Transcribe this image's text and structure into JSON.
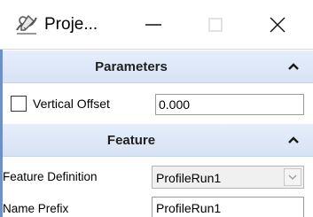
{
  "window": {
    "title": "Proje...",
    "controls": {
      "minimize": "minimize-icon",
      "maximize": "maximize-icon",
      "close": "close-icon"
    },
    "app_icon": "project-profile-icon"
  },
  "colors": {
    "section_header_top": "#e6eefb",
    "section_header_bottom": "#d6e2f5",
    "accent_strip": "#6f8fc9"
  },
  "sections": {
    "parameters": {
      "title": "Parameters",
      "collapse_icon": "chevron-up-icon",
      "vertical_offset": {
        "label": "Vertical Offset",
        "value": "0.000",
        "checked": false
      }
    },
    "feature": {
      "title": "Feature",
      "collapse_icon": "chevron-up-icon",
      "feature_definition": {
        "label": "Feature Definition",
        "value": "ProfileRun1",
        "arrow_icon": "chevron-down-icon"
      },
      "name_prefix": {
        "label": "Name Prefix",
        "value": "ProfileRun1"
      }
    }
  }
}
